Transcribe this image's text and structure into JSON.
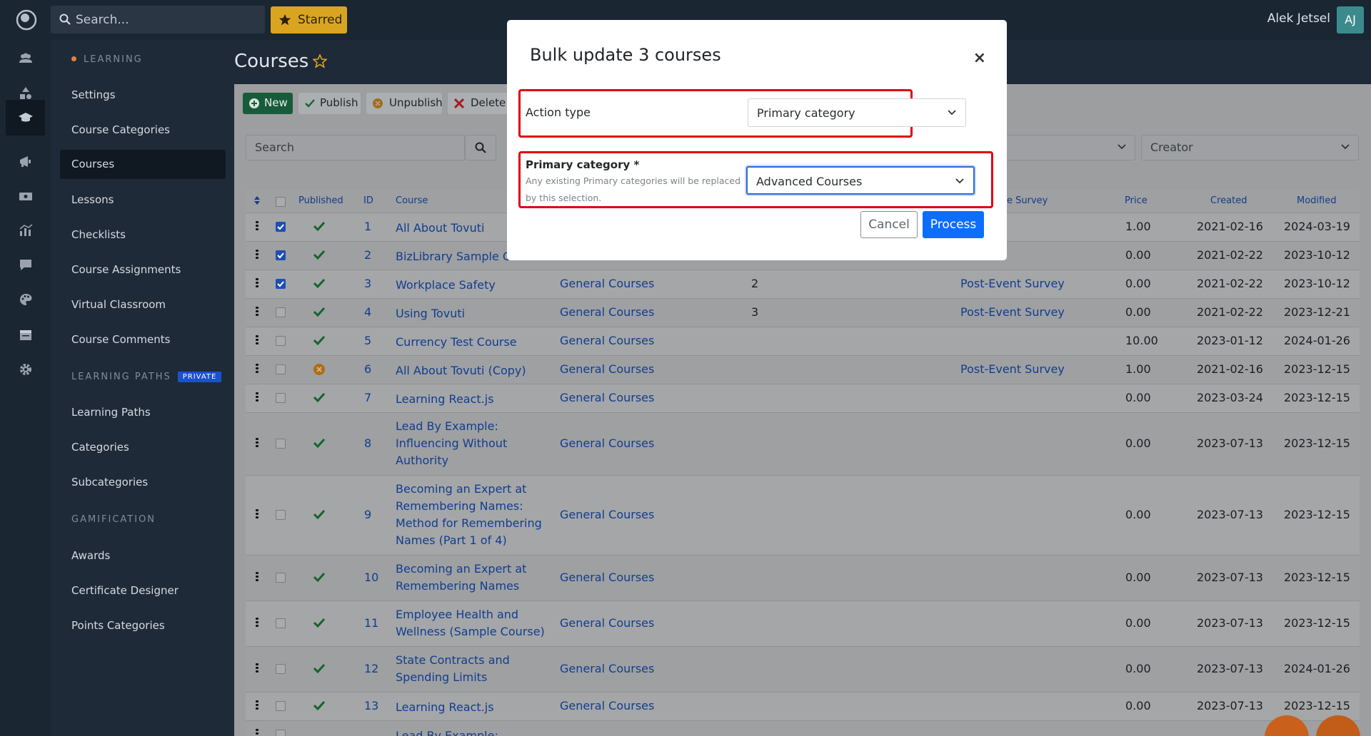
{
  "topbar": {
    "search_placeholder": "Search...",
    "starred_label": "Starred",
    "user_name": "Alek Jetsel",
    "avatar_initials": "AJ"
  },
  "sidebar": {
    "section_learning": "LEARNING",
    "learning_items": [
      "Settings",
      "Course Categories",
      "Courses",
      "Lessons",
      "Checklists",
      "Course Assignments",
      "Virtual Classroom",
      "Course Comments"
    ],
    "section_paths": "LEARNING PATHS",
    "paths_badge": "PRIVATE",
    "paths_items": [
      "Learning Paths",
      "Categories",
      "Subcategories"
    ],
    "section_gamification": "GAMIFICATION",
    "gamification_items": [
      "Awards",
      "Certificate Designer",
      "Points Categories"
    ]
  },
  "page": {
    "title": "Courses",
    "toolbar": {
      "new": "New",
      "publish": "Publish",
      "unpublish": "Unpublish",
      "delete": "Delete"
    },
    "filter_search": "Search",
    "filter_creator": "Creator"
  },
  "table": {
    "headers": {
      "published": "Published",
      "id": "ID",
      "course": "Course",
      "survey": "e Survey",
      "price": "Price",
      "created": "Created",
      "modified": "Modified"
    },
    "rows": [
      {
        "id": "1",
        "course": [
          "All About Tovuti"
        ],
        "category": "",
        "col4": "",
        "survey": "",
        "price": "1.00",
        "created": "2021-02-16",
        "modified": "2024-03-19",
        "checked": true,
        "status": "check"
      },
      {
        "id": "2",
        "course": [
          "BizLibrary Sample Co"
        ],
        "category": "",
        "col4": "",
        "survey": "",
        "price": "0.00",
        "created": "2021-02-22",
        "modified": "2023-10-12",
        "checked": true,
        "status": "check"
      },
      {
        "id": "3",
        "course": [
          "Workplace Safety"
        ],
        "category": "General Courses",
        "col4": "2",
        "survey": "Post-Event Survey",
        "price": "0.00",
        "created": "2021-02-22",
        "modified": "2023-10-12",
        "checked": true,
        "status": "check"
      },
      {
        "id": "4",
        "course": [
          "Using Tovuti"
        ],
        "category": "General Courses",
        "col4": "3",
        "survey": "Post-Event Survey",
        "price": "0.00",
        "created": "2021-02-22",
        "modified": "2023-12-21",
        "checked": false,
        "status": "check"
      },
      {
        "id": "5",
        "course": [
          "Currency Test Course"
        ],
        "category": "General Courses",
        "col4": "",
        "survey": "",
        "price": "10.00",
        "created": "2023-01-12",
        "modified": "2024-01-26",
        "checked": false,
        "status": "check"
      },
      {
        "id": "6",
        "course": [
          "All About Tovuti (Copy)"
        ],
        "category": "General Courses",
        "col4": "",
        "survey": "Post-Event Survey",
        "price": "1.00",
        "created": "2021-02-16",
        "modified": "2023-12-15",
        "checked": false,
        "status": "unpublished"
      },
      {
        "id": "7",
        "course": [
          "Learning React.js"
        ],
        "category": "General Courses",
        "col4": "",
        "survey": "",
        "price": "0.00",
        "created": "2023-03-24",
        "modified": "2023-12-15",
        "checked": false,
        "status": "check"
      },
      {
        "id": "8",
        "course": [
          "Lead By Example:",
          "Influencing Without",
          "Authority"
        ],
        "category": "General Courses",
        "col4": "",
        "survey": "",
        "price": "0.00",
        "created": "2023-07-13",
        "modified": "2023-12-15",
        "checked": false,
        "status": "check"
      },
      {
        "id": "9",
        "course": [
          "Becoming an Expert at",
          "Remembering Names:",
          "Method for Remembering",
          "Names (Part 1 of 4)"
        ],
        "category": "General Courses",
        "col4": "",
        "survey": "",
        "price": "0.00",
        "created": "2023-07-13",
        "modified": "2023-12-15",
        "checked": false,
        "status": "check"
      },
      {
        "id": "10",
        "course": [
          "Becoming an Expert at",
          "Remembering Names"
        ],
        "category": "General Courses",
        "col4": "",
        "survey": "",
        "price": "0.00",
        "created": "2023-07-13",
        "modified": "2023-12-15",
        "checked": false,
        "status": "check"
      },
      {
        "id": "11",
        "course": [
          "Employee Health and",
          "Wellness (Sample Course)"
        ],
        "category": "General Courses",
        "col4": "",
        "survey": "",
        "price": "0.00",
        "created": "2023-07-13",
        "modified": "2023-12-15",
        "checked": false,
        "status": "check"
      },
      {
        "id": "12",
        "course": [
          "State Contracts and",
          "Spending Limits"
        ],
        "category": "General Courses",
        "col4": "",
        "survey": "",
        "price": "0.00",
        "created": "2023-07-13",
        "modified": "2024-01-26",
        "checked": false,
        "status": "check"
      },
      {
        "id": "13",
        "course": [
          "Learning React.js"
        ],
        "category": "General Courses",
        "col4": "",
        "survey": "",
        "price": "0.00",
        "created": "2023-07-13",
        "modified": "2023-12-15",
        "checked": false,
        "status": "check"
      },
      {
        "id": "",
        "course": [
          "Lead By Example:"
        ],
        "category": "",
        "col4": "",
        "survey": "",
        "price": "",
        "created": "",
        "modified": "",
        "checked": false,
        "status": "none"
      }
    ]
  },
  "modal": {
    "title": "Bulk update 3 courses",
    "close": "×",
    "action_type_label": "Action type",
    "action_type_value": "Primary category",
    "primary_category_label": "Primary category *",
    "primary_category_help_1": "Any existing Primary categories will be replaced",
    "primary_category_help_2": "by this selection.",
    "primary_category_value": "Advanced Courses",
    "cancel": "Cancel",
    "process": "Process"
  },
  "colors": {
    "accent": "#0d6efd",
    "highlight": "#e00016",
    "check": "#16632f",
    "starred": "#d9a521"
  }
}
